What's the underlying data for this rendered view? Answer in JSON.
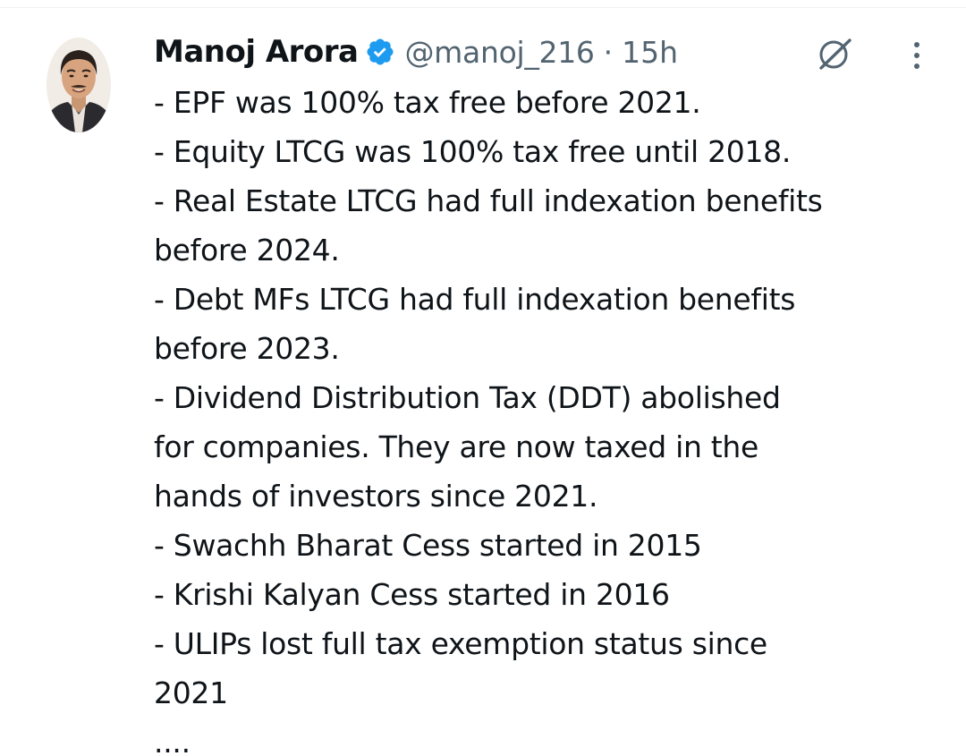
{
  "author": {
    "name": "Manoj Arora",
    "handle": "@manoj_216",
    "separator": "·",
    "timestamp": "15h",
    "verified": true
  },
  "icons": {
    "verified": "verified-badge-icon",
    "grok": "grok-icon",
    "more": "more-vertical-icon"
  },
  "colors": {
    "verified_blue": "#1d9bf0",
    "text_primary": "#0f1419",
    "text_secondary": "#536471"
  },
  "tweet": {
    "lines": [
      "- EPF was 100% tax free before 2021.",
      "- Equity LTCG was 100% tax free until 2018.",
      "- Real Estate LTCG had full indexation benefits",
      "before 2024.",
      "- Debt MFs LTCG had full indexation benefits",
      "before 2023.",
      "- Dividend Distribution Tax (DDT) abolished",
      "for companies. They are now taxed in the",
      "hands of investors since 2021.",
      "- Swachh Bharat Cess started in 2015",
      "- Krishi Kalyan Cess started in 2016",
      "- ULIPs lost full tax exemption status since",
      "2021",
      "...."
    ]
  }
}
